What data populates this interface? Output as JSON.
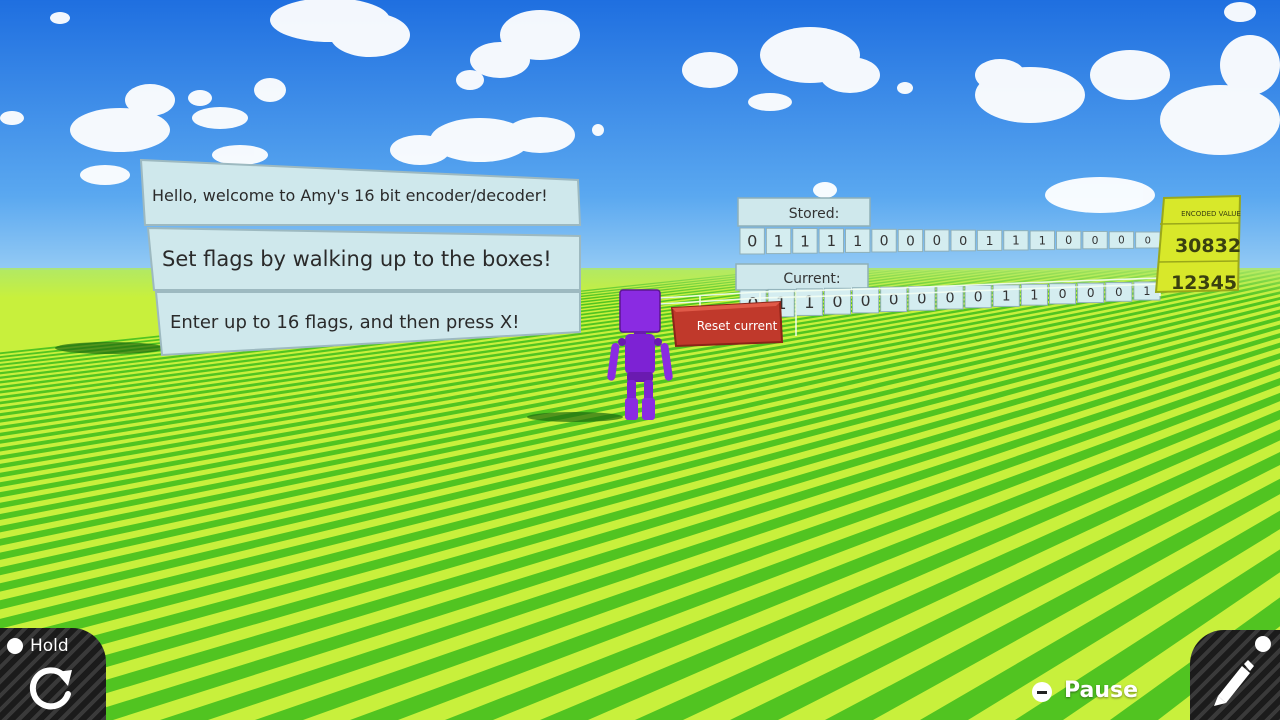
{
  "signs": [
    "Hello, welcome to Amy's 16 bit encoder/decoder!",
    "Set flags by walking up to the boxes!",
    "Enter up to 16 flags, and then press X!"
  ],
  "stored": {
    "label": "Stored:",
    "bits": [
      "0",
      "1",
      "1",
      "1",
      "1",
      "0",
      "0",
      "0",
      "0",
      "1",
      "1",
      "1",
      "0",
      "0",
      "0",
      "0"
    ]
  },
  "current": {
    "label": "Current:",
    "bits": [
      "0",
      "1",
      "1",
      "0",
      "0",
      "0",
      "0",
      "0",
      "0",
      "1",
      "1",
      "0",
      "0",
      "0",
      "1"
    ]
  },
  "reset_label": "Reset current",
  "panel": {
    "header": "ENCODED VALUE",
    "stored_value": "30832",
    "current_value": "12345"
  },
  "hud": {
    "hold_label": "Hold",
    "pause_label": "Pause"
  },
  "colors": {
    "sky": "#3d86e6",
    "grass_light": "#c8f03c",
    "grass_dark": "#3cbc1c",
    "robot": "#8a2be2",
    "reset": "#c0392b",
    "panel": "#d8e82a"
  }
}
